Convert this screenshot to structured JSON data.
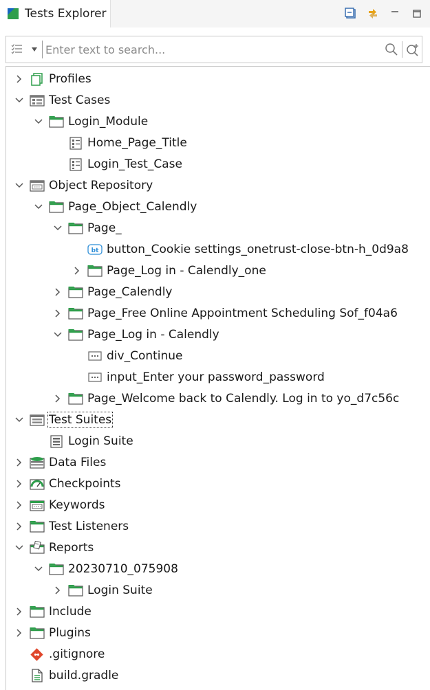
{
  "panel": {
    "title": "Tests Explorer"
  },
  "search": {
    "placeholder": "Enter text to search..."
  },
  "tree": [
    {
      "label": "Profiles",
      "icon": "profiles-icon",
      "depth": 0,
      "state": "collapsed"
    },
    {
      "label": "Test Cases",
      "icon": "test-cases-folder-icon",
      "depth": 0,
      "state": "expanded"
    },
    {
      "label": "Login_Module",
      "icon": "folder-icon",
      "depth": 1,
      "state": "expanded"
    },
    {
      "label": "Home_Page_Title",
      "icon": "test-case-icon",
      "depth": 2,
      "state": "leaf"
    },
    {
      "label": "Login_Test_Case",
      "icon": "test-case-icon",
      "depth": 2,
      "state": "leaf"
    },
    {
      "label": "Object Repository",
      "icon": "object-repository-icon",
      "depth": 0,
      "state": "expanded"
    },
    {
      "label": "Page_Object_Calendly",
      "icon": "folder-icon",
      "depth": 1,
      "state": "expanded"
    },
    {
      "label": "Page_",
      "icon": "folder-icon",
      "depth": 2,
      "state": "expanded"
    },
    {
      "label": "button_Cookie settings_onetrust-close-btn-h_0d9a8",
      "icon": "button-object-icon",
      "depth": 3,
      "state": "leaf"
    },
    {
      "label": "Page_Log in - Calendly_one",
      "icon": "folder-icon",
      "depth": 3,
      "state": "collapsed"
    },
    {
      "label": "Page_Calendly",
      "icon": "folder-icon",
      "depth": 2,
      "state": "collapsed"
    },
    {
      "label": "Page_Free Online Appointment Scheduling Sof_f04a6",
      "icon": "folder-icon",
      "depth": 2,
      "state": "collapsed"
    },
    {
      "label": "Page_Log in - Calendly",
      "icon": "folder-icon",
      "depth": 2,
      "state": "expanded"
    },
    {
      "label": "div_Continue",
      "icon": "web-element-icon",
      "depth": 3,
      "state": "leaf"
    },
    {
      "label": "input_Enter your password_password",
      "icon": "web-element-icon",
      "depth": 3,
      "state": "leaf"
    },
    {
      "label": "Page_Welcome back to Calendly. Log in to yo_d7c56c",
      "icon": "folder-icon",
      "depth": 2,
      "state": "collapsed"
    },
    {
      "label": "Test Suites",
      "icon": "test-suites-folder-icon",
      "depth": 0,
      "state": "expanded",
      "selected": true
    },
    {
      "label": "Login Suite",
      "icon": "test-suite-icon",
      "depth": 1,
      "state": "leaf"
    },
    {
      "label": "Data Files",
      "icon": "data-files-icon",
      "depth": 0,
      "state": "collapsed"
    },
    {
      "label": "Checkpoints",
      "icon": "checkpoints-icon",
      "depth": 0,
      "state": "collapsed"
    },
    {
      "label": "Keywords",
      "icon": "keywords-icon",
      "depth": 0,
      "state": "collapsed"
    },
    {
      "label": "Test Listeners",
      "icon": "folder-icon",
      "depth": 0,
      "state": "collapsed"
    },
    {
      "label": "Reports",
      "icon": "reports-icon",
      "depth": 0,
      "state": "expanded"
    },
    {
      "label": "20230710_075908",
      "icon": "folder-icon",
      "depth": 1,
      "state": "expanded"
    },
    {
      "label": "Login Suite",
      "icon": "folder-icon",
      "depth": 2,
      "state": "collapsed"
    },
    {
      "label": "Include",
      "icon": "folder-icon",
      "depth": 0,
      "state": "collapsed"
    },
    {
      "label": "Plugins",
      "icon": "folder-icon",
      "depth": 0,
      "state": "collapsed"
    },
    {
      "label": ".gitignore",
      "icon": "git-icon",
      "depth": 0,
      "state": "none"
    },
    {
      "label": "build.gradle",
      "icon": "file-icon",
      "depth": 0,
      "state": "none"
    }
  ]
}
